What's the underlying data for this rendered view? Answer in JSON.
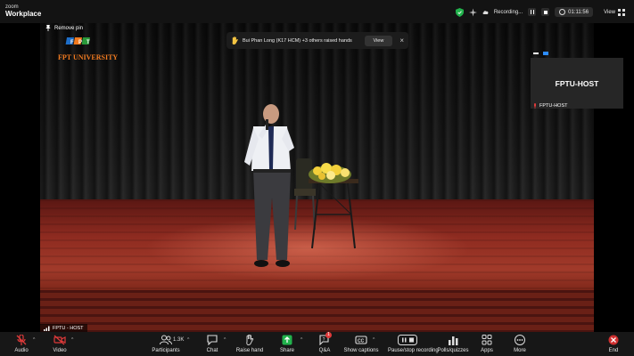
{
  "app": {
    "brand_top": "zoom",
    "brand_bottom": "Workplace"
  },
  "top_bar": {
    "recording_label": "Recording...",
    "timer": "01:11:56",
    "view_label": "View"
  },
  "video": {
    "remove_pin_label": "Remove pin",
    "logo_text": "FPT UNIVERSITY",
    "speaker_name": "FPTU - HOST"
  },
  "notification": {
    "text": "Bui Phan Long (K17 HCM) +3 others raised hands",
    "view_button": "View",
    "close_glyph": "×"
  },
  "self_tile": {
    "name": "FPTU-HOST",
    "label": "FPTU-HOST"
  },
  "toolbar": {
    "audio": "Audio",
    "video": "Video",
    "participants": "Participants",
    "participant_count": "1.3K",
    "chat": "Chat",
    "raise_hand": "Raise hand",
    "share": "Share",
    "qa": "Q&A",
    "qa_badge": "1",
    "captions": "Show captions",
    "recording": "Pause/stop recording",
    "polls": "Polls/quizzes",
    "apps": "Apps",
    "more": "More",
    "end": "End"
  },
  "colors": {
    "accent_green": "#22b24c",
    "record_red": "#e03a3a",
    "end_red": "#d03030",
    "logo_orange": "#f07a20"
  }
}
